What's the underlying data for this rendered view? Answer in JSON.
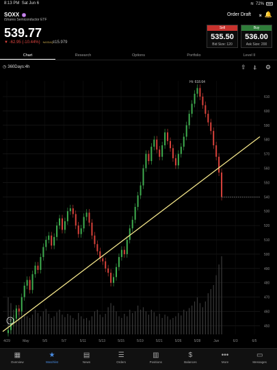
{
  "status": {
    "time": "8:13 PM",
    "date": "Sat Jun 6",
    "battery": "72%"
  },
  "header": {
    "symbol": "SOXX",
    "full_name": "iShares Semiconductor ETF",
    "price": "539.77",
    "change": "▼ -62.95 (-10.44%)",
    "exchange": "NASDAQ",
    "volume": "≡15.979",
    "order_draft": "Order Draft"
  },
  "quote": {
    "sell": {
      "label": "Sell",
      "price": "535.50",
      "size": "Bid Size: 120"
    },
    "buy": {
      "label": "Buy",
      "price": "536.00",
      "size": "Ask Size: 200"
    }
  },
  "tabs": [
    "Chart",
    "Research",
    "Options",
    "Portfolio",
    "Level II"
  ],
  "active_tab": "Chart",
  "chart_toolbar": {
    "timeframe": "360Days:4h"
  },
  "chart_data": {
    "type": "candlestick",
    "x_tick_labels": [
      "4/29",
      "May",
      "5/5",
      "5/7",
      "5/11",
      "5/13",
      "5/15",
      "5/19",
      "5/21",
      "5/26",
      "5/28",
      "Jun",
      "6/3",
      "6/5"
    ],
    "y_tick_labels": [
      "450",
      "460",
      "470",
      "480",
      "490",
      "500",
      "510",
      "520",
      "530",
      "540",
      "550",
      "560",
      "570",
      "580",
      "590",
      "600",
      "610"
    ],
    "ylim": [
      444,
      621
    ],
    "high_annotation": "Hi: 618.64",
    "last_price": 539.77,
    "trendline": {
      "start": [
        0,
        446
      ],
      "end": [
        1,
        582
      ]
    },
    "closes": [
      447,
      452,
      455,
      462,
      460,
      470,
      478,
      482,
      475,
      486,
      492,
      489,
      498,
      505,
      510,
      513,
      506,
      512,
      520,
      525,
      517,
      523,
      530,
      532,
      528,
      520,
      514,
      518,
      526,
      529,
      522,
      513,
      507,
      502,
      497,
      495,
      490,
      487,
      480,
      484,
      491,
      498,
      503,
      500,
      510,
      518,
      524,
      533,
      541,
      548,
      560,
      570,
      565,
      575,
      580,
      573,
      568,
      576,
      585,
      579,
      574,
      567,
      562,
      570,
      575,
      582,
      590,
      598,
      605,
      612,
      616,
      610,
      604,
      598,
      592,
      586,
      576,
      568,
      557,
      540
    ],
    "volumes": [
      0.45,
      0.38,
      0.3,
      0.35,
      0.28,
      0.3,
      0.25,
      0.22,
      0.2,
      0.24,
      0.3,
      0.26,
      0.22,
      0.28,
      0.31,
      0.25,
      0.2,
      0.22,
      0.27,
      0.3,
      0.24,
      0.21,
      0.25,
      0.23,
      0.2,
      0.18,
      0.26,
      0.22,
      0.19,
      0.2,
      0.17,
      0.22,
      0.28,
      0.3,
      0.24,
      0.21,
      0.25,
      0.33,
      0.38,
      0.35,
      0.28,
      0.22,
      0.2,
      0.25,
      0.22,
      0.3,
      0.26,
      0.28,
      0.35,
      0.3,
      0.33,
      0.28,
      0.24,
      0.3,
      0.27,
      0.22,
      0.25,
      0.2,
      0.24,
      0.22,
      0.18,
      0.2,
      0.22,
      0.26,
      0.23,
      0.3,
      0.28,
      0.32,
      0.35,
      0.4,
      0.45,
      0.38,
      0.33,
      0.4,
      0.5,
      0.55,
      0.6,
      0.72,
      0.85,
      0.95
    ],
    "colors": {
      "up": "#3fae4f",
      "down": "#d9423b",
      "trendline": "#f3e58a",
      "volume": "#3a3a3a",
      "grid": "#1f1f1f",
      "axis_text": "#8a8a8a"
    }
  },
  "bottom_nav": [
    {
      "label": "Overview",
      "icon": "overview-icon"
    },
    {
      "label": "Watchlist",
      "icon": "watchlist-icon"
    },
    {
      "label": "News",
      "icon": "news-icon"
    },
    {
      "label": "Orders",
      "icon": "orders-icon"
    },
    {
      "label": "Positions",
      "icon": "positions-icon"
    },
    {
      "label": "Balances",
      "icon": "balances-icon"
    },
    {
      "label": "More",
      "icon": "more-icon"
    },
    {
      "label": "Messages",
      "icon": "messages-icon"
    }
  ],
  "active_nav": "Watchlist"
}
